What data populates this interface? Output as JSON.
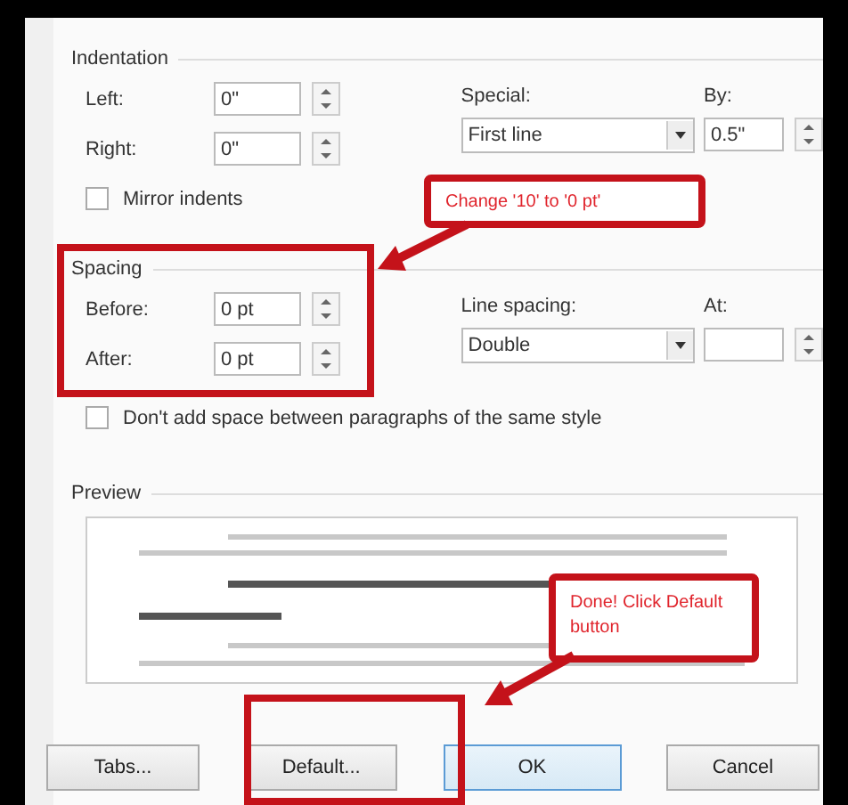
{
  "indentation": {
    "title": "Indentation",
    "fields": [
      {
        "label": "Left:",
        "value": "0\""
      },
      {
        "label": "Right:",
        "value": "0\""
      }
    ],
    "special": {
      "label": "Special:",
      "value": "First line"
    },
    "by": {
      "label": "By:",
      "value": "0.5\""
    },
    "mirror_indents": {
      "label": "Mirror indents",
      "checked": false
    }
  },
  "spacing": {
    "title": "Spacing",
    "fields": [
      {
        "label": "Before:",
        "value": "0 pt"
      },
      {
        "label": "After:",
        "value": "0 pt"
      }
    ],
    "line_spacing": {
      "label": "Line spacing:",
      "value": "Double"
    },
    "at": {
      "label": "At:"
    },
    "dont_add_space": {
      "label": "Don't add space between paragraphs of the same style",
      "checked": false
    }
  },
  "preview": {
    "title": "Preview"
  },
  "buttons": [
    {
      "label": "Tabs...",
      "primary": false
    },
    {
      "label": "Default...",
      "primary": false
    },
    {
      "label": "OK",
      "primary": true
    },
    {
      "label": "Cancel",
      "primary": false
    }
  ],
  "annotations": [
    {
      "text": "Change '10' to '0 pt'"
    },
    {
      "text": "Done! Click Default button"
    }
  ]
}
